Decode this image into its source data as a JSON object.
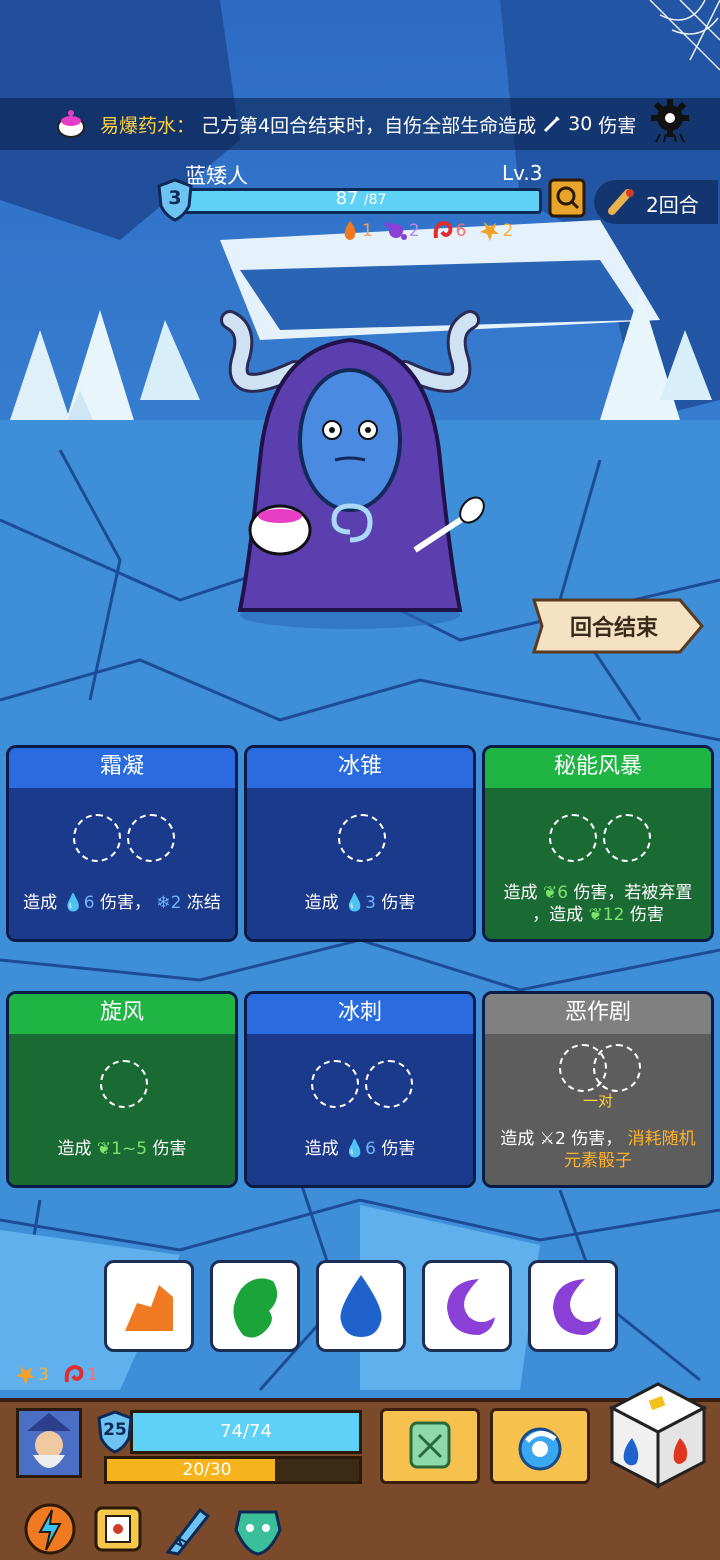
{
  "buff": {
    "name": "易爆药水：",
    "desc": "己方第4回合结束时，自伤全部生命造成",
    "damage": "30",
    "suffix": "伤害"
  },
  "enemy": {
    "name": "蓝矮人",
    "level": "Lv.3",
    "shield": "3",
    "hp": "87",
    "hp_max": "/87",
    "turns": "2回合",
    "statuses": [
      {
        "icon": "fire-icon",
        "value": "1"
      },
      {
        "icon": "purple-splash-icon",
        "value": "2"
      },
      {
        "icon": "red-swirl-icon",
        "value": "6"
      },
      {
        "icon": "orange-burst-icon",
        "value": "2"
      }
    ]
  },
  "end_turn_label": "回合结束",
  "cards": [
    {
      "title": "霜凝",
      "color": "blue",
      "desc_prefix": "造成",
      "v1": "6",
      "mid": "伤害，",
      "v2": "2",
      "tail": "冻结"
    },
    {
      "title": "冰锥",
      "color": "blue",
      "desc_prefix": "造成",
      "v1": "3",
      "tail": "伤害"
    },
    {
      "title": "秘能风暴",
      "color": "green",
      "desc_prefix": "造成",
      "v1": "6",
      "mid": "伤害，若被弃置",
      "line2_prefix": "，造成",
      "v2": "12",
      "tail": "伤害"
    },
    {
      "title": "旋风",
      "color": "green",
      "desc_prefix": "造成",
      "v1": "1~5",
      "tail": "伤害"
    },
    {
      "title": "冰刺",
      "color": "blue",
      "desc_prefix": "造成",
      "v1": "6",
      "tail": "伤害"
    },
    {
      "title": "恶作剧",
      "color": "gray",
      "pair_label": "一对",
      "desc_prefix": "造成",
      "v1": "2",
      "mid": "伤害，",
      "orange1": "消耗随机",
      "orange2": "元素骰子"
    }
  ],
  "dice": [
    "earth-die-icon",
    "leaf-die-icon",
    "water-die-icon",
    "moon-die-icon",
    "moon-die-icon"
  ],
  "player": {
    "statuses": [
      {
        "icon": "orange-burst-icon",
        "value": "3"
      },
      {
        "icon": "red-swirl-icon",
        "value": "1"
      }
    ],
    "level": "25",
    "hp": "74/74",
    "mana": "20/30",
    "mana_fraction": 0.667
  },
  "colors": {
    "card_blue_title": "#2a6be0",
    "card_green_title": "#1fb443",
    "card_gray_title": "#808080",
    "hp_bar": "#5fd1f7",
    "mana_bar": "#f6b41c",
    "buff_name": "#ffd23a"
  }
}
